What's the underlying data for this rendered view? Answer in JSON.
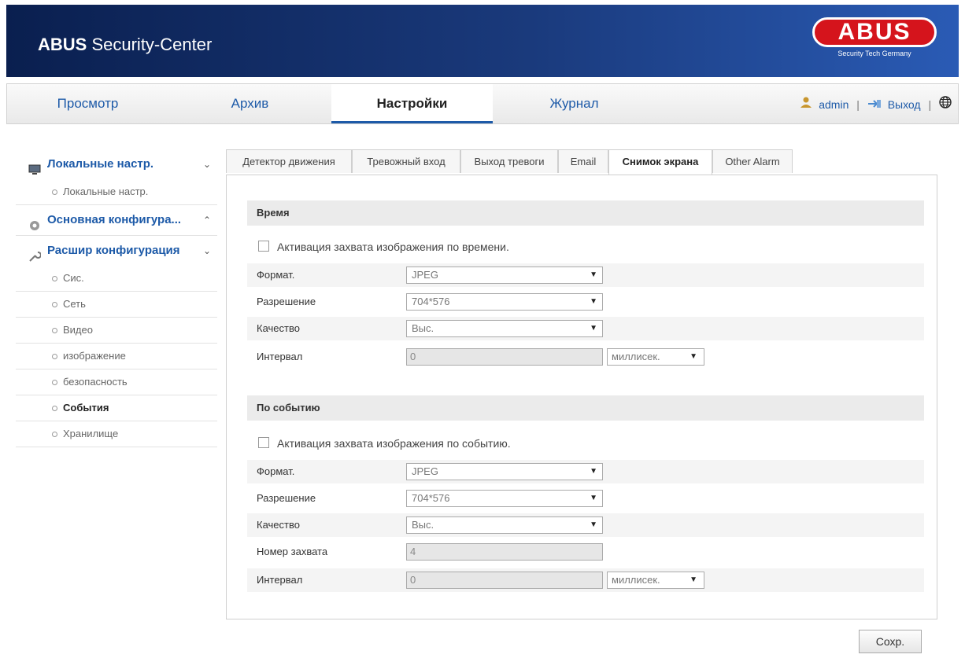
{
  "header": {
    "title_bold": "ABUS",
    "title_rest": " Security-Center",
    "logo_text": "ABUS",
    "logo_tagline": "Security Tech Germany"
  },
  "nav": {
    "tabs": [
      "Просмотр",
      "Архив",
      "Настройки",
      "Журнал"
    ],
    "active_tab": "Настройки",
    "user": "admin",
    "logout": "Выход"
  },
  "sidebar": {
    "group1": {
      "label": "Локальные настр.",
      "items": [
        "Локальные настр."
      ]
    },
    "group2": {
      "label": "Основная конфигура..."
    },
    "group3": {
      "label": "Расшир конфигурация",
      "items": [
        "Сис.",
        "Сеть",
        "Видео",
        "изображение",
        "безопасность",
        "События",
        "Хранилище"
      ],
      "active_item": "События"
    }
  },
  "subtabs": [
    "Детектор движения",
    "Тревожный вход",
    "Выход тревоги",
    "Email",
    "Снимок экрана",
    "Other Alarm"
  ],
  "active_subtab": "Снимок экрана",
  "time_section": {
    "title": "Время",
    "checkbox_label": "Активация захвата изображения по времени.",
    "format_label": "Формат.",
    "format_value": "JPEG",
    "resolution_label": "Разрешение",
    "resolution_value": "704*576",
    "quality_label": "Качество",
    "quality_value": "Выс.",
    "interval_label": "Интервал",
    "interval_value": "0",
    "interval_unit": "миллисек."
  },
  "event_section": {
    "title": "По событию",
    "checkbox_label": "Активация захвата изображения по событию.",
    "format_label": "Формат.",
    "format_value": "JPEG",
    "resolution_label": "Разрешение",
    "resolution_value": "704*576",
    "quality_label": "Качество",
    "quality_value": "Выс.",
    "capture_label": "Номер захвата",
    "capture_value": "4",
    "interval_label": "Интервал",
    "interval_value": "0",
    "interval_unit": "миллисек."
  },
  "save_label": "Сохр."
}
